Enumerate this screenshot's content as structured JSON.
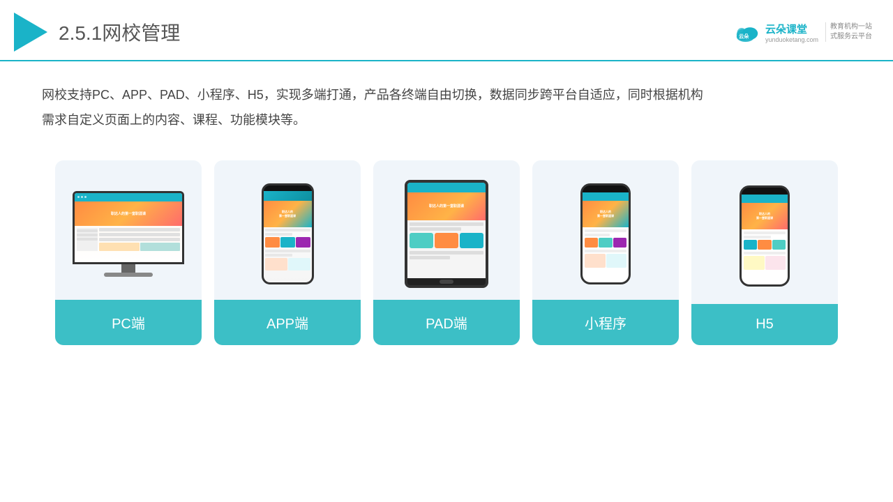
{
  "header": {
    "title_prefix": "2.5.1",
    "title_main": "网校管理",
    "brand_name": "云朵课堂",
    "brand_url": "yunduoketang.com",
    "brand_subtitle": "教育机构一站\n式服务云平台"
  },
  "description": "网校支持PC、APP、PAD、小程序、H5，实现多端打通，产品各终端自由切换，数据同步跨平台自适应，同时根据机构需求自定义页面上的内容、课程、功能模块等。",
  "cards": [
    {
      "id": "pc",
      "label": "PC端"
    },
    {
      "id": "app",
      "label": "APP端"
    },
    {
      "id": "pad",
      "label": "PAD端"
    },
    {
      "id": "miniprogram",
      "label": "小程序"
    },
    {
      "id": "h5",
      "label": "H5"
    }
  ],
  "colors": {
    "teal": "#3cbfc6",
    "teal_dark": "#1ab3c8",
    "card_bg": "#f0f5fa"
  }
}
